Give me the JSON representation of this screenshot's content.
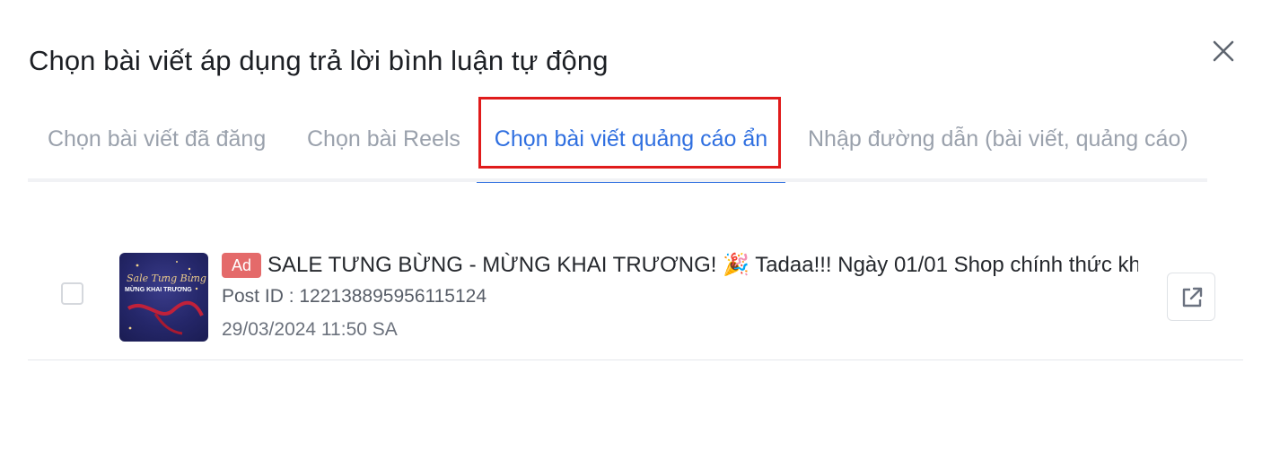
{
  "dialog": {
    "title": "Chọn bài viết áp dụng trả lời bình luận tự động"
  },
  "tabs": [
    {
      "label": "Chọn bài viết đã đăng",
      "active": false
    },
    {
      "label": "Chọn bài Reels",
      "active": false
    },
    {
      "label": "Chọn bài viết quảng cáo ẩn",
      "active": true
    },
    {
      "label": "Nhập đường dẫn (bài viết, quảng cáo)",
      "active": false
    }
  ],
  "posts": [
    {
      "checked": false,
      "badge": "Ad",
      "text": "SALE TƯNG BỪNG - MỪNG KHAI TRƯƠNG! 🎉 Tadaa!!! Ngày 01/01 Shop chính thức khai trương",
      "post_id": "Post ID : 122138895956115124",
      "date": "29/03/2024 11:50 SA",
      "thumbnail": {
        "line1": "Sale Tưng Bừng",
        "line2": "MỪNG KHAI TRƯƠNG"
      }
    }
  ],
  "colors": {
    "accent": "#2f6fe0",
    "highlight_box": "#e01b1b",
    "ad_badge": "#e46a6a",
    "inactive_tab": "#9aa1ac"
  },
  "icons": {
    "close": "close-icon",
    "open": "external-link-icon"
  }
}
